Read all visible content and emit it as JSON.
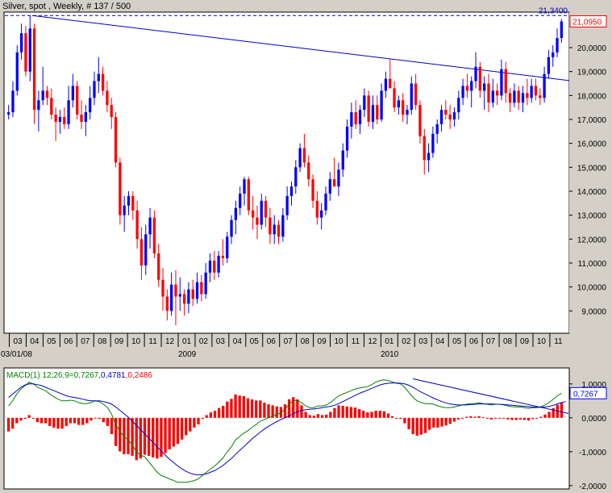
{
  "window": {
    "title": "Silver, spot , Weekly, # 137 / 500"
  },
  "colors": {
    "bull": "#0000ff",
    "bear": "#ff0000",
    "macd_line": "#008000",
    "signal_line": "#0000c0",
    "histogram": "#ff0000",
    "trendline": "#0000c0",
    "last_price_box": "#ff0000",
    "macd_box": "#0000ff"
  },
  "chart_data": [
    {
      "type": "candlestick",
      "title": "Silver, spot , Weekly, # 137 / 500",
      "ylim": [
        8.1,
        21.45
      ],
      "y_ticks": [
        "9,0000",
        "10,0000",
        "11,0000",
        "12,0000",
        "13,0000",
        "14,0000",
        "15,0000",
        "16,0000",
        "17,0000",
        "18,0000",
        "19,0000",
        "20,0000"
      ],
      "hline": {
        "value": "21,3400"
      },
      "last_price": "21,0950",
      "x_month_labels": [
        "03",
        "04",
        "05",
        "06",
        "07",
        "08",
        "09",
        "10",
        "11",
        "12",
        "01",
        "02",
        "03",
        "04",
        "05",
        "06",
        "07",
        "08",
        "09",
        "10",
        "11",
        "12",
        "01",
        "02",
        "03",
        "04",
        "05",
        "06",
        "07",
        "08",
        "09",
        "10",
        "11"
      ],
      "x_year_labels": [
        "03/01/08",
        "2009",
        "2010"
      ],
      "candles": [
        {
          "o": 17.2,
          "h": 17.6,
          "l": 17.0,
          "c": 17.3
        },
        {
          "o": 17.3,
          "h": 18.6,
          "l": 17.1,
          "c": 18.2
        },
        {
          "o": 18.2,
          "h": 20.1,
          "l": 18.0,
          "c": 19.8
        },
        {
          "o": 19.8,
          "h": 21.0,
          "l": 19.5,
          "c": 20.6
        },
        {
          "o": 20.6,
          "h": 20.9,
          "l": 18.8,
          "c": 19.0
        },
        {
          "o": 19.0,
          "h": 21.34,
          "l": 18.6,
          "c": 20.8
        },
        {
          "o": 20.8,
          "h": 21.0,
          "l": 16.8,
          "c": 17.4
        },
        {
          "o": 17.4,
          "h": 18.2,
          "l": 16.5,
          "c": 17.8
        },
        {
          "o": 17.8,
          "h": 19.2,
          "l": 17.6,
          "c": 18.2
        },
        {
          "o": 18.2,
          "h": 18.4,
          "l": 17.6,
          "c": 17.9
        },
        {
          "o": 17.9,
          "h": 18.3,
          "l": 17.0,
          "c": 17.2
        },
        {
          "o": 17.2,
          "h": 17.5,
          "l": 16.1,
          "c": 16.9
        },
        {
          "o": 16.9,
          "h": 17.4,
          "l": 16.4,
          "c": 17.1
        },
        {
          "o": 17.1,
          "h": 17.5,
          "l": 16.6,
          "c": 16.8
        },
        {
          "o": 16.8,
          "h": 18.4,
          "l": 16.6,
          "c": 17.8
        },
        {
          "o": 17.8,
          "h": 18.9,
          "l": 17.5,
          "c": 18.4
        },
        {
          "o": 18.4,
          "h": 18.6,
          "l": 17.0,
          "c": 17.2
        },
        {
          "o": 17.2,
          "h": 17.8,
          "l": 16.6,
          "c": 16.9
        },
        {
          "o": 16.9,
          "h": 17.6,
          "l": 16.3,
          "c": 17.3
        },
        {
          "o": 17.3,
          "h": 18.4,
          "l": 17.0,
          "c": 17.9
        },
        {
          "o": 17.9,
          "h": 19.0,
          "l": 17.6,
          "c": 18.6
        },
        {
          "o": 18.6,
          "h": 19.6,
          "l": 18.1,
          "c": 18.9
        },
        {
          "o": 18.9,
          "h": 19.2,
          "l": 18.0,
          "c": 18.2
        },
        {
          "o": 18.2,
          "h": 18.6,
          "l": 17.3,
          "c": 17.6
        },
        {
          "o": 17.6,
          "h": 17.9,
          "l": 16.6,
          "c": 17.1
        },
        {
          "o": 17.1,
          "h": 17.3,
          "l": 15.0,
          "c": 15.2
        },
        {
          "o": 15.2,
          "h": 15.4,
          "l": 12.6,
          "c": 13.0
        },
        {
          "o": 13.0,
          "h": 13.8,
          "l": 12.3,
          "c": 13.4
        },
        {
          "o": 13.4,
          "h": 14.0,
          "l": 13.0,
          "c": 13.8
        },
        {
          "o": 13.8,
          "h": 14.0,
          "l": 12.8,
          "c": 13.2
        },
        {
          "o": 13.2,
          "h": 13.6,
          "l": 11.6,
          "c": 12.0
        },
        {
          "o": 12.0,
          "h": 12.5,
          "l": 10.3,
          "c": 10.9
        },
        {
          "o": 10.9,
          "h": 12.6,
          "l": 10.5,
          "c": 12.2
        },
        {
          "o": 12.2,
          "h": 13.3,
          "l": 11.6,
          "c": 12.9
        },
        {
          "o": 12.9,
          "h": 13.2,
          "l": 11.2,
          "c": 11.4
        },
        {
          "o": 11.4,
          "h": 11.8,
          "l": 10.0,
          "c": 10.3
        },
        {
          "o": 10.3,
          "h": 10.8,
          "l": 9.0,
          "c": 9.6
        },
        {
          "o": 9.6,
          "h": 9.9,
          "l": 8.6,
          "c": 9.0
        },
        {
          "o": 9.0,
          "h": 10.6,
          "l": 8.8,
          "c": 10.1
        },
        {
          "o": 10.1,
          "h": 10.7,
          "l": 8.4,
          "c": 9.6
        },
        {
          "o": 9.6,
          "h": 10.4,
          "l": 9.0,
          "c": 9.7
        },
        {
          "o": 9.7,
          "h": 9.9,
          "l": 8.8,
          "c": 9.3
        },
        {
          "o": 9.3,
          "h": 10.2,
          "l": 8.9,
          "c": 9.9
        },
        {
          "o": 9.9,
          "h": 10.3,
          "l": 9.2,
          "c": 9.5
        },
        {
          "o": 9.5,
          "h": 10.6,
          "l": 9.3,
          "c": 10.2
        },
        {
          "o": 10.2,
          "h": 10.5,
          "l": 9.4,
          "c": 9.7
        },
        {
          "o": 9.7,
          "h": 11.0,
          "l": 9.5,
          "c": 10.6
        },
        {
          "o": 10.6,
          "h": 11.4,
          "l": 10.2,
          "c": 11.1
        },
        {
          "o": 11.1,
          "h": 11.5,
          "l": 10.3,
          "c": 10.6
        },
        {
          "o": 10.6,
          "h": 11.5,
          "l": 10.4,
          "c": 11.3
        },
        {
          "o": 11.3,
          "h": 12.0,
          "l": 10.9,
          "c": 11.2
        },
        {
          "o": 11.2,
          "h": 12.3,
          "l": 11.0,
          "c": 12.1
        },
        {
          "o": 12.1,
          "h": 13.0,
          "l": 11.8,
          "c": 12.8
        },
        {
          "o": 12.8,
          "h": 13.6,
          "l": 12.2,
          "c": 13.3
        },
        {
          "o": 13.3,
          "h": 14.2,
          "l": 13.0,
          "c": 13.9
        },
        {
          "o": 13.9,
          "h": 14.6,
          "l": 13.4,
          "c": 14.5
        },
        {
          "o": 14.5,
          "h": 14.6,
          "l": 13.0,
          "c": 13.2
        },
        {
          "o": 13.2,
          "h": 13.8,
          "l": 12.4,
          "c": 12.9
        },
        {
          "o": 12.9,
          "h": 13.4,
          "l": 12.0,
          "c": 12.6
        },
        {
          "o": 12.6,
          "h": 13.9,
          "l": 12.4,
          "c": 13.6
        },
        {
          "o": 13.6,
          "h": 13.8,
          "l": 12.5,
          "c": 12.9
        },
        {
          "o": 12.9,
          "h": 13.3,
          "l": 11.8,
          "c": 12.2
        },
        {
          "o": 12.2,
          "h": 13.0,
          "l": 11.8,
          "c": 12.6
        },
        {
          "o": 12.6,
          "h": 12.8,
          "l": 11.8,
          "c": 12.1
        },
        {
          "o": 12.1,
          "h": 13.3,
          "l": 11.9,
          "c": 13.0
        },
        {
          "o": 13.0,
          "h": 14.2,
          "l": 12.8,
          "c": 13.8
        },
        {
          "o": 13.8,
          "h": 14.4,
          "l": 13.4,
          "c": 14.2
        },
        {
          "o": 14.2,
          "h": 15.3,
          "l": 13.9,
          "c": 15.0
        },
        {
          "o": 15.0,
          "h": 16.0,
          "l": 14.8,
          "c": 15.8
        },
        {
          "o": 15.8,
          "h": 16.4,
          "l": 15.0,
          "c": 15.2
        },
        {
          "o": 15.2,
          "h": 15.5,
          "l": 14.2,
          "c": 14.5
        },
        {
          "o": 14.5,
          "h": 14.7,
          "l": 13.3,
          "c": 13.6
        },
        {
          "o": 13.6,
          "h": 14.0,
          "l": 12.6,
          "c": 12.9
        },
        {
          "o": 12.9,
          "h": 13.5,
          "l": 12.4,
          "c": 13.2
        },
        {
          "o": 13.2,
          "h": 14.2,
          "l": 13.0,
          "c": 13.9
        },
        {
          "o": 13.9,
          "h": 14.8,
          "l": 13.6,
          "c": 14.5
        },
        {
          "o": 14.5,
          "h": 15.4,
          "l": 14.2,
          "c": 14.2
        },
        {
          "o": 14.2,
          "h": 15.2,
          "l": 13.8,
          "c": 14.9
        },
        {
          "o": 14.9,
          "h": 16.0,
          "l": 14.6,
          "c": 15.7
        },
        {
          "o": 15.7,
          "h": 17.0,
          "l": 15.4,
          "c": 16.7
        },
        {
          "o": 16.7,
          "h": 17.7,
          "l": 16.2,
          "c": 17.3
        },
        {
          "o": 17.3,
          "h": 17.8,
          "l": 16.6,
          "c": 16.8
        },
        {
          "o": 16.8,
          "h": 17.6,
          "l": 16.4,
          "c": 17.4
        },
        {
          "o": 17.4,
          "h": 18.3,
          "l": 17.1,
          "c": 18.0
        },
        {
          "o": 18.0,
          "h": 18.2,
          "l": 16.7,
          "c": 16.9
        },
        {
          "o": 16.9,
          "h": 18.0,
          "l": 16.6,
          "c": 17.6
        },
        {
          "o": 17.6,
          "h": 18.0,
          "l": 16.8,
          "c": 17.0
        },
        {
          "o": 17.0,
          "h": 18.5,
          "l": 16.9,
          "c": 18.2
        },
        {
          "o": 18.2,
          "h": 19.0,
          "l": 17.9,
          "c": 18.7
        },
        {
          "o": 18.7,
          "h": 19.5,
          "l": 18.3,
          "c": 18.3
        },
        {
          "o": 18.3,
          "h": 18.6,
          "l": 17.3,
          "c": 17.5
        },
        {
          "o": 17.5,
          "h": 18.0,
          "l": 17.2,
          "c": 17.8
        },
        {
          "o": 17.8,
          "h": 18.1,
          "l": 16.9,
          "c": 17.2
        },
        {
          "o": 17.2,
          "h": 17.6,
          "l": 16.8,
          "c": 17.4
        },
        {
          "o": 17.4,
          "h": 18.8,
          "l": 17.2,
          "c": 18.5
        },
        {
          "o": 18.5,
          "h": 18.9,
          "l": 17.4,
          "c": 17.6
        },
        {
          "o": 17.6,
          "h": 17.8,
          "l": 16.0,
          "c": 16.3
        },
        {
          "o": 16.3,
          "h": 16.6,
          "l": 14.7,
          "c": 15.3
        },
        {
          "o": 15.3,
          "h": 16.0,
          "l": 14.8,
          "c": 15.6
        },
        {
          "o": 15.6,
          "h": 16.7,
          "l": 15.4,
          "c": 16.4
        },
        {
          "o": 16.4,
          "h": 17.0,
          "l": 16.0,
          "c": 16.8
        },
        {
          "o": 16.8,
          "h": 17.6,
          "l": 16.5,
          "c": 17.4
        },
        {
          "o": 17.4,
          "h": 17.8,
          "l": 17.0,
          "c": 17.2
        },
        {
          "o": 17.2,
          "h": 17.6,
          "l": 16.6,
          "c": 17.0
        },
        {
          "o": 17.0,
          "h": 17.5,
          "l": 16.7,
          "c": 17.3
        },
        {
          "o": 17.3,
          "h": 18.2,
          "l": 17.0,
          "c": 17.9
        },
        {
          "o": 17.9,
          "h": 18.7,
          "l": 17.6,
          "c": 18.4
        },
        {
          "o": 18.4,
          "h": 18.9,
          "l": 17.9,
          "c": 18.2
        },
        {
          "o": 18.2,
          "h": 18.8,
          "l": 17.5,
          "c": 18.6
        },
        {
          "o": 18.6,
          "h": 19.8,
          "l": 18.3,
          "c": 19.2
        },
        {
          "o": 19.2,
          "h": 19.4,
          "l": 17.9,
          "c": 18.2
        },
        {
          "o": 18.2,
          "h": 18.8,
          "l": 17.4,
          "c": 18.5
        },
        {
          "o": 18.5,
          "h": 18.9,
          "l": 17.3,
          "c": 17.7
        },
        {
          "o": 17.7,
          "h": 18.7,
          "l": 17.5,
          "c": 18.2
        },
        {
          "o": 18.2,
          "h": 18.5,
          "l": 17.6,
          "c": 18.0
        },
        {
          "o": 18.0,
          "h": 19.5,
          "l": 17.8,
          "c": 19.1
        },
        {
          "o": 19.1,
          "h": 19.4,
          "l": 17.7,
          "c": 18.1
        },
        {
          "o": 18.1,
          "h": 18.3,
          "l": 17.3,
          "c": 17.7
        },
        {
          "o": 17.7,
          "h": 18.5,
          "l": 17.5,
          "c": 18.2
        },
        {
          "o": 18.2,
          "h": 18.4,
          "l": 17.4,
          "c": 17.7
        },
        {
          "o": 17.7,
          "h": 18.4,
          "l": 17.3,
          "c": 18.1
        },
        {
          "o": 18.1,
          "h": 18.7,
          "l": 17.6,
          "c": 17.9
        },
        {
          "o": 17.9,
          "h": 18.7,
          "l": 17.7,
          "c": 18.4
        },
        {
          "o": 18.4,
          "h": 18.7,
          "l": 17.8,
          "c": 18.0
        },
        {
          "o": 18.0,
          "h": 18.3,
          "l": 17.6,
          "c": 17.9
        },
        {
          "o": 17.9,
          "h": 19.2,
          "l": 17.7,
          "c": 18.9
        },
        {
          "o": 18.9,
          "h": 19.9,
          "l": 18.7,
          "c": 19.6
        },
        {
          "o": 19.6,
          "h": 20.1,
          "l": 19.2,
          "c": 19.8
        },
        {
          "o": 19.8,
          "h": 20.8,
          "l": 19.6,
          "c": 20.4
        },
        {
          "o": 20.4,
          "h": 21.2,
          "l": 20.2,
          "c": 21.095
        }
      ],
      "trendlines": [
        {
          "from": {
            "i": 5.5,
            "v": 21.34
          },
          "to": {
            "i": 136.5,
            "v": 18.5
          }
        }
      ]
    },
    {
      "type": "macd",
      "label": "MACD(1) 12;26;9=",
      "values_text": {
        "macd": "0,7267",
        "signal": "0,4781",
        "histogram": "0,2486"
      },
      "last_value": "0,7267",
      "ylim": [
        -2.05,
        1.4
      ],
      "y_ticks": [
        "1,0000",
        "0,0000",
        "-1,0000",
        "-2,0000"
      ],
      "macd_series": [
        0.35,
        0.5,
        0.7,
        0.85,
        0.95,
        1.05,
        1.0,
        0.9,
        0.85,
        0.8,
        0.7,
        0.62,
        0.55,
        0.5,
        0.5,
        0.52,
        0.5,
        0.45,
        0.42,
        0.42,
        0.45,
        0.5,
        0.48,
        0.4,
        0.3,
        0.1,
        -0.2,
        -0.4,
        -0.55,
        -0.65,
        -0.8,
        -1.0,
        -1.1,
        -1.15,
        -1.3,
        -1.45,
        -1.6,
        -1.7,
        -1.75,
        -1.8,
        -1.85,
        -1.9,
        -1.9,
        -1.9,
        -1.88,
        -1.85,
        -1.8,
        -1.7,
        -1.6,
        -1.5,
        -1.42,
        -1.3,
        -1.18,
        -1.0,
        -0.85,
        -0.65,
        -0.55,
        -0.45,
        -0.38,
        -0.28,
        -0.2,
        -0.1,
        -0.05,
        0.0,
        0.05,
        0.1,
        0.15,
        0.25,
        0.4,
        0.5,
        0.52,
        0.45,
        0.35,
        0.3,
        0.3,
        0.35,
        0.35,
        0.38,
        0.45,
        0.55,
        0.65,
        0.7,
        0.75,
        0.8,
        0.85,
        0.88,
        0.9,
        0.92,
        0.98,
        1.05,
        1.1,
        1.12,
        1.1,
        1.06,
        1.02,
        1.0,
        0.9,
        0.75,
        0.6,
        0.5,
        0.45,
        0.42,
        0.42,
        0.4,
        0.35,
        0.32,
        0.3,
        0.3,
        0.32,
        0.35,
        0.38,
        0.4,
        0.42,
        0.42,
        0.44,
        0.42,
        0.4,
        0.38,
        0.4,
        0.4,
        0.38,
        0.35,
        0.33,
        0.32,
        0.32,
        0.3,
        0.28,
        0.3,
        0.3,
        0.33,
        0.38,
        0.45,
        0.55,
        0.65,
        0.7267
      ],
      "signal_series": [
        0.6,
        0.7,
        0.8,
        0.9,
        0.97,
        1.0,
        1.0,
        0.98,
        0.95,
        0.9,
        0.85,
        0.8,
        0.75,
        0.7,
        0.65,
        0.62,
        0.6,
        0.58,
        0.55,
        0.52,
        0.5,
        0.5,
        0.5,
        0.48,
        0.45,
        0.4,
        0.32,
        0.22,
        0.12,
        0.02,
        -0.1,
        -0.22,
        -0.35,
        -0.47,
        -0.6,
        -0.72,
        -0.85,
        -0.98,
        -1.1,
        -1.22,
        -1.32,
        -1.42,
        -1.5,
        -1.58,
        -1.63,
        -1.67,
        -1.68,
        -1.68,
        -1.65,
        -1.6,
        -1.55,
        -1.48,
        -1.4,
        -1.3,
        -1.2,
        -1.08,
        -0.96,
        -0.85,
        -0.74,
        -0.62,
        -0.52,
        -0.42,
        -0.33,
        -0.25,
        -0.18,
        -0.11,
        -0.05,
        0.0,
        0.06,
        0.12,
        0.18,
        0.22,
        0.24,
        0.25,
        0.26,
        0.28,
        0.3,
        0.32,
        0.34,
        0.37,
        0.42,
        0.48,
        0.54,
        0.6,
        0.66,
        0.72,
        0.77,
        0.82,
        0.87,
        0.92,
        0.97,
        1.0,
        1.02,
        1.03,
        1.03,
        1.02,
        1.0,
        0.96,
        0.9,
        0.83,
        0.76,
        0.7,
        0.64,
        0.58,
        0.53,
        0.48,
        0.44,
        0.41,
        0.39,
        0.38,
        0.38,
        0.38,
        0.39,
        0.4,
        0.41,
        0.41,
        0.41,
        0.41,
        0.4,
        0.4,
        0.39,
        0.38,
        0.37,
        0.36,
        0.35,
        0.34,
        0.33,
        0.32,
        0.31,
        0.31,
        0.32,
        0.34,
        0.37,
        0.41,
        0.45,
        0.4781
      ],
      "trendlines": [
        {
          "from": {
            "i": 98,
            "v": 1.15
          },
          "to": {
            "i": 136,
            "v": 0.12
          }
        }
      ]
    }
  ]
}
